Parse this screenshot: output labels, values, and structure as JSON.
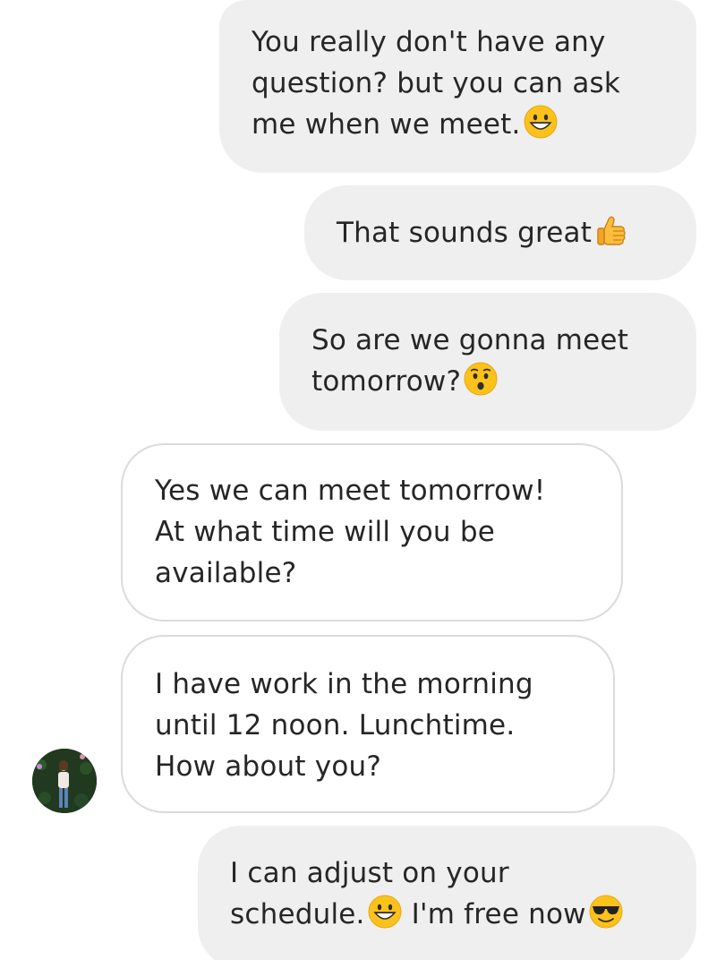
{
  "conversation": {
    "messages": [
      {
        "sender": "me",
        "lines": [
          {
            "text": "You really don't have any"
          },
          {
            "text": "question? but you can ask"
          },
          {
            "text": "me when we meet.",
            "emoji": "grinning-face-icon"
          }
        ]
      },
      {
        "sender": "me",
        "lines": [
          {
            "text": "That sounds great",
            "emoji": "thumbs-up-icon"
          }
        ]
      },
      {
        "sender": "me",
        "lines": [
          {
            "text": "So are we gonna meet"
          },
          {
            "text": "tomorrow?",
            "emoji": "hushed-face-icon"
          }
        ]
      },
      {
        "sender": "other",
        "lines": [
          {
            "text": "Yes we can meet tomorrow!"
          },
          {
            "text": "At what time will you be"
          },
          {
            "text": "available?"
          }
        ]
      },
      {
        "sender": "other",
        "lines": [
          {
            "text": "I have work in the morning"
          },
          {
            "text": "until 12 noon. Lunchtime."
          },
          {
            "text": "How about you?"
          }
        ]
      },
      {
        "sender": "me",
        "lines": [
          {
            "text": "I can adjust on your"
          },
          {
            "text": "schedule.",
            "emoji": "grinning-face-icon"
          },
          {
            "text": " I'm free now",
            "emoji": "sunglasses-face-icon"
          }
        ]
      }
    ],
    "avatar_icon": "contact-avatar",
    "colors": {
      "sent_bubble": "#efefef",
      "received_border": "#dbdbdb",
      "text": "#262626"
    }
  }
}
